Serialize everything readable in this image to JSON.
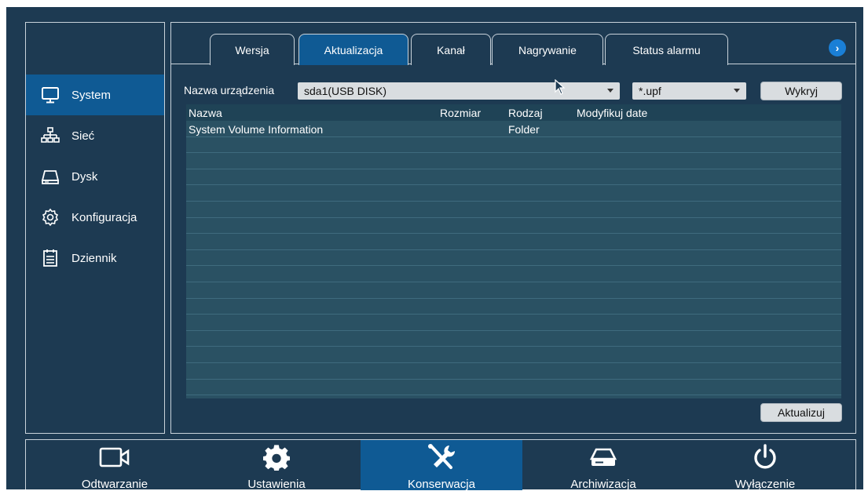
{
  "sidebar": {
    "items": [
      {
        "label": "System",
        "icon": "monitor-icon",
        "active": true
      },
      {
        "label": "Sieć",
        "icon": "network-icon",
        "active": false
      },
      {
        "label": "Dysk",
        "icon": "disk-icon",
        "active": false
      },
      {
        "label": "Konfiguracja",
        "icon": "gear-icon",
        "active": false
      },
      {
        "label": "Dziennik",
        "icon": "log-icon",
        "active": false
      }
    ]
  },
  "tabs": [
    {
      "label": "Wersja",
      "active": false
    },
    {
      "label": "Aktualizacja",
      "active": true
    },
    {
      "label": "Kanał",
      "active": false
    },
    {
      "label": "Nagrywanie",
      "active": false
    },
    {
      "label": "Status alarmu",
      "active": false
    }
  ],
  "tab_next_glyph": "›",
  "update": {
    "device_label": "Nazwa urządzenia",
    "device_value": "sda1(USB DISK)",
    "filter_value": "*.upf",
    "detect_button": "Wykryj",
    "update_button": "Aktualizuj"
  },
  "table": {
    "columns": [
      "Nazwa",
      "Rozmiar",
      "Rodzaj",
      "Modyfikuj date"
    ],
    "rows": [
      [
        "System Volume Information",
        "",
        "Folder",
        ""
      ],
      [
        "",
        "",
        "",
        ""
      ],
      [
        "",
        "",
        "",
        ""
      ],
      [
        "",
        "",
        "",
        ""
      ],
      [
        "",
        "",
        "",
        ""
      ],
      [
        "",
        "",
        "",
        ""
      ],
      [
        "",
        "",
        "",
        ""
      ],
      [
        "",
        "",
        "",
        ""
      ],
      [
        "",
        "",
        "",
        ""
      ],
      [
        "",
        "",
        "",
        ""
      ],
      [
        "",
        "",
        "",
        ""
      ],
      [
        "",
        "",
        "",
        ""
      ],
      [
        "",
        "",
        "",
        ""
      ],
      [
        "",
        "",
        "",
        ""
      ],
      [
        "",
        "",
        "",
        ""
      ],
      [
        "",
        "",
        "",
        ""
      ],
      [
        "",
        "",
        "",
        ""
      ]
    ]
  },
  "bottom_nav": [
    {
      "label": "Odtwarzanie",
      "icon": "playback-camera-icon",
      "active": false
    },
    {
      "label": "Ustawienia",
      "icon": "settings-gear-icon",
      "active": false
    },
    {
      "label": "Konserwacja",
      "icon": "tools-icon",
      "active": true
    },
    {
      "label": "Archiwizacja",
      "icon": "archive-drive-icon",
      "active": false
    },
    {
      "label": "Wyłączenie",
      "icon": "power-icon",
      "active": false
    }
  ],
  "colors": {
    "background": "#1d3a52",
    "accent": "#0f5a94",
    "table_bg": "#2a5163",
    "control_bg": "#d9dde0"
  }
}
